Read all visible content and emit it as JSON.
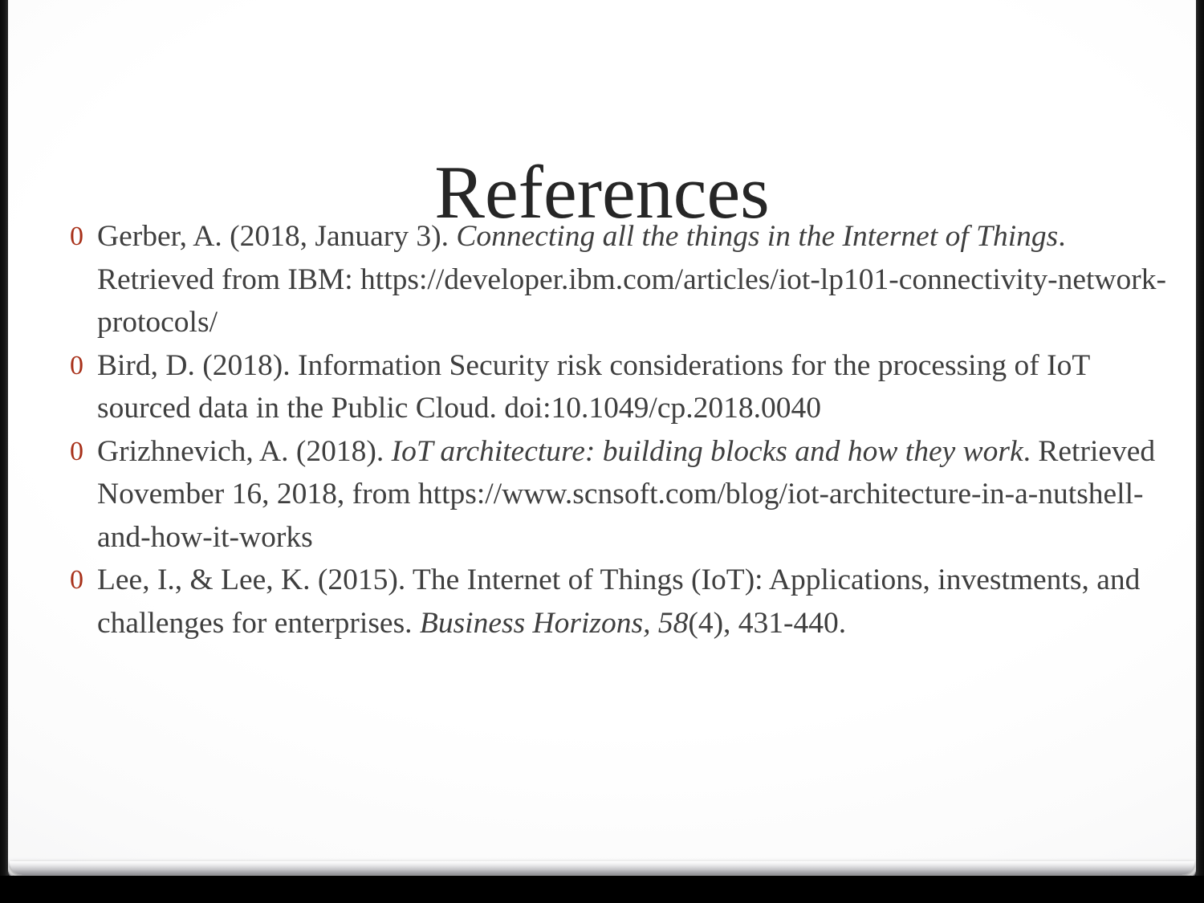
{
  "slide": {
    "title": "References",
    "bullet_glyph": "0",
    "bullet_color": "#a8311a",
    "title_color": "#262626",
    "text_color": "#3f3f3f",
    "background_color": "#ffffff",
    "canvas_color": "#000000"
  },
  "references": [
    {
      "id": "ref-gerber-2018",
      "parts": [
        {
          "style": "normal",
          "text": "Gerber, A. (2018, January 3). "
        },
        {
          "style": "italic",
          "text": "Connecting all the things in the Internet of Things"
        },
        {
          "style": "normal",
          "text": ". Retrieved from IBM: https://developer.ibm.com/articles/iot-lp101-connectivity-network-protocols/"
        }
      ],
      "plain": "Gerber, A. (2018, January 3). Connecting all the things in the Internet of Things. Retrieved from IBM: https://developer.ibm.com/articles/iot-lp101-connectivity-network-protocols/"
    },
    {
      "id": "ref-bird-2018",
      "parts": [
        {
          "style": "normal",
          "text": "Bird, D. (2018). Information Security risk considerations for the processing of IoT sourced data in the Public Cloud. doi:10.1049/cp.2018.0040"
        }
      ],
      "plain": "Bird, D. (2018). Information Security risk considerations for the processing of IoT sourced data in the Public Cloud. doi:10.1049/cp.2018.0040"
    },
    {
      "id": "ref-grizhnevich-2018",
      "parts": [
        {
          "style": "normal",
          "text": "Grizhnevich, A. (2018). "
        },
        {
          "style": "italic",
          "text": "IoT architecture: building blocks and how they work"
        },
        {
          "style": "normal",
          "text": ". Retrieved November 16, 2018, from https://www.scnsoft.com/blog/iot-architecture-in-a-nutshell-and-how-it-works"
        }
      ],
      "plain": "Grizhnevich, A. (2018). IoT architecture: building blocks and how they work. Retrieved November 16, 2018, from https://www.scnsoft.com/blog/iot-architecture-in-a-nutshell-and-how-it-works"
    },
    {
      "id": "ref-lee-lee-2015",
      "parts": [
        {
          "style": "normal",
          "text": "Lee, I., & Lee, K. (2015). The Internet of Things (IoT): Applications, investments, and challenges for enterprises. "
        },
        {
          "style": "italic",
          "text": "Business Horizons, 58"
        },
        {
          "style": "normal",
          "text": "(4), 431-440."
        }
      ],
      "plain": "Lee, I., & Lee, K. (2015). The Internet of Things (IoT): Applications, investments, and challenges for enterprises. Business Horizons, 58(4), 431-440."
    }
  ]
}
